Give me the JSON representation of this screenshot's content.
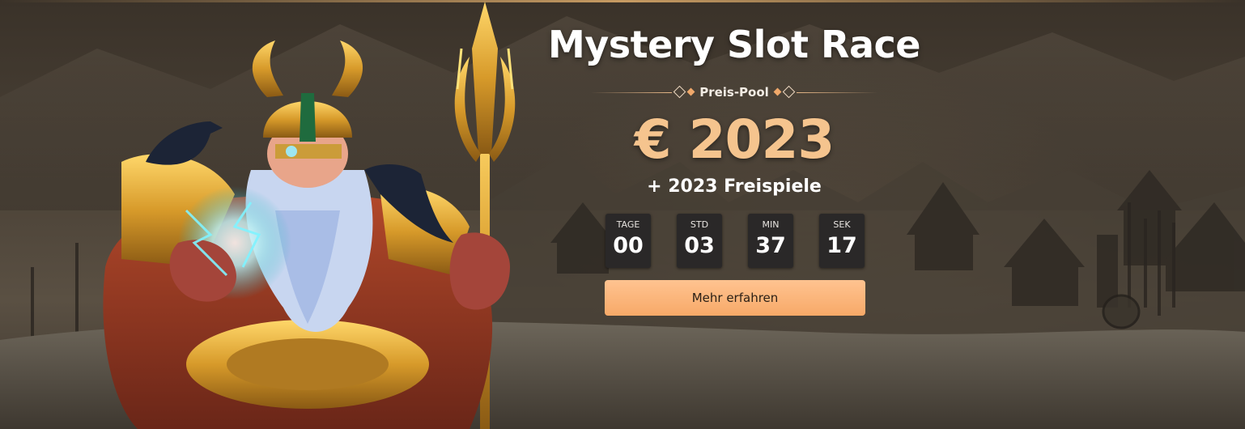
{
  "banner": {
    "title": "Mystery Slot Race",
    "pool_label": "Preis-Pool",
    "prize_amount": "€ 2023",
    "free_spins": "+ 2023 Freispiele",
    "countdown": [
      {
        "label": "TAGE",
        "value": "00"
      },
      {
        "label": "STD",
        "value": "03"
      },
      {
        "label": "MIN",
        "value": "37"
      },
      {
        "label": "SEK",
        "value": "17"
      }
    ],
    "cta_label": "Mehr erfahren"
  },
  "colors": {
    "accent_orange": "#f7a968",
    "prize_gold": "#f5c48e",
    "countdown_box": "#2a2828",
    "background": "#4a4136"
  },
  "images": {
    "hero": "viking-god-with-trident-illustration",
    "background": "snowy-viking-village-scene"
  }
}
